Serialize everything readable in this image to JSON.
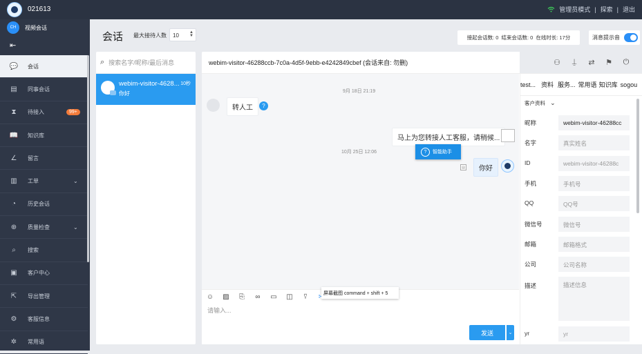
{
  "topbar": {
    "agent_id": "021613",
    "admin_mode": "管理员模式",
    "explore": "探索",
    "logout": "退出",
    "sep": "|"
  },
  "sidebar": {
    "video_chat": "视频会话",
    "video_icon_text": "CH",
    "items": [
      {
        "label": "会话",
        "icon": "chat-icon",
        "glyph": "💬"
      },
      {
        "label": "同事会话",
        "icon": "colleague-icon",
        "glyph": "▤"
      },
      {
        "label": "待接入",
        "icon": "hourglass-icon",
        "glyph": "⧗",
        "badge": "99+"
      },
      {
        "label": "知识库",
        "icon": "book-icon",
        "glyph": "📖"
      },
      {
        "label": "留言",
        "icon": "pen-icon",
        "glyph": "∠"
      },
      {
        "label": "工单",
        "icon": "ticket-icon",
        "glyph": "▥"
      },
      {
        "label": "历史会话",
        "icon": "history-icon",
        "glyph": "◔"
      },
      {
        "label": "质量检查",
        "icon": "shield-icon",
        "glyph": "⊕"
      },
      {
        "label": "搜索",
        "icon": "search-icon",
        "glyph": "⌕"
      },
      {
        "label": "客户中心",
        "icon": "customer-icon",
        "glyph": "▣"
      },
      {
        "label": "导出管理",
        "icon": "export-icon",
        "glyph": "⇱"
      },
      {
        "label": "客服信息",
        "icon": "gear-icon",
        "glyph": "⚙"
      },
      {
        "label": "常用语",
        "icon": "phrase-icon",
        "glyph": "✲"
      }
    ]
  },
  "header": {
    "title": "会话",
    "max_label": "最大接待人数",
    "max_value": "10",
    "stats": {
      "started": "接起会话数: 0",
      "ended": "结束会话数: 0",
      "online": "在线时长: 17分"
    },
    "notify_label": "消息提示音"
  },
  "list": {
    "search_placeholder": "搜索名字/昵称/最后消息",
    "conversation": {
      "name": "webim-visitor-4628...",
      "time": "10秒",
      "last_msg": "你好"
    }
  },
  "chat": {
    "title": "webim-visitor-46288ccb-7c0a-4d5f-9ebb-e4242849cbef (会话来自: 勿删)",
    "date1": "9月 18日 21:19",
    "date2": "10月 25日 12:06",
    "msg_user": "转人工",
    "msg_bot": "马上为您转接人工客服，请稍候...",
    "msg_agent": "你好",
    "smart_assistant": "智能助手",
    "tooltip": "屏幕截图 command + shift + 5",
    "input_placeholder": "请输入...",
    "send": "发送"
  },
  "right": {
    "tabs": [
      "test...",
      "资料",
      "服务...",
      "常用语",
      "知识库",
      "sogou"
    ],
    "section": "客户资料",
    "fields": [
      {
        "label": "昵称",
        "value": "webim-visitor-46288cc",
        "filled": true
      },
      {
        "label": "名字",
        "value": "真实姓名",
        "filled": false
      },
      {
        "label": "ID",
        "value": "webim-visitor-46288c",
        "filled": false
      },
      {
        "label": "手机",
        "value": "手机号",
        "filled": false
      },
      {
        "label": "QQ",
        "value": "QQ号",
        "filled": false
      },
      {
        "label": "微信号",
        "value": "微信号",
        "filled": false
      },
      {
        "label": "邮箱",
        "value": "邮箱格式",
        "filled": false
      },
      {
        "label": "公司",
        "value": "公司名称",
        "filled": false
      }
    ],
    "desc_label": "描述",
    "desc_placeholder": "描述信息",
    "yr_label": "yr",
    "yr_placeholder": "yr"
  }
}
